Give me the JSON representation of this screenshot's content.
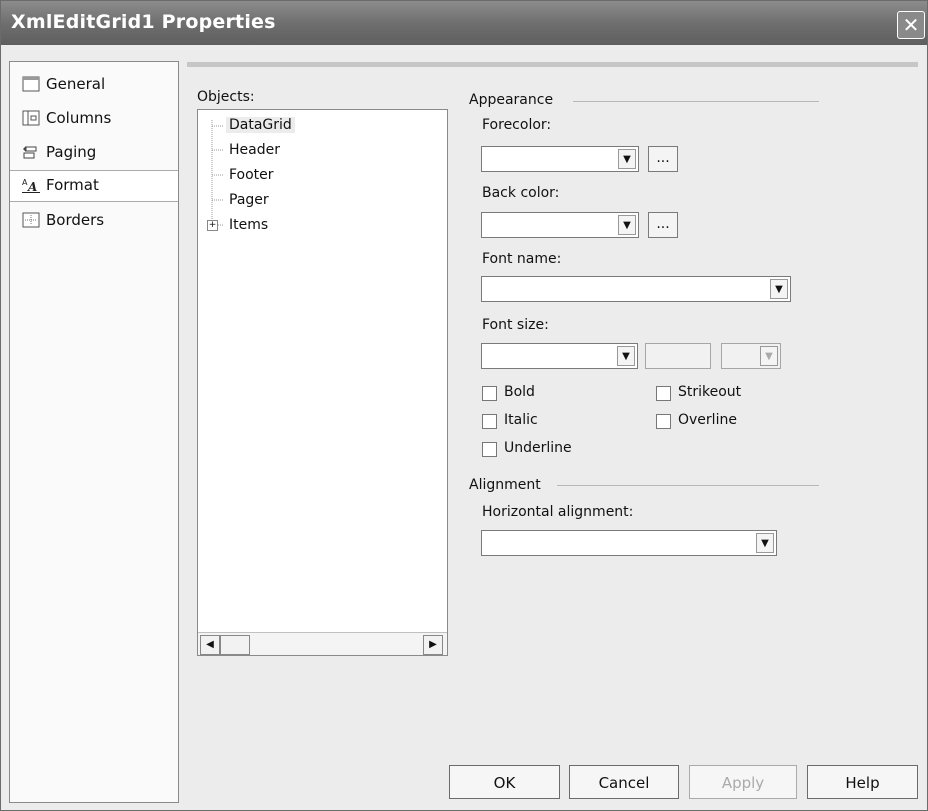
{
  "window": {
    "title": "XmlEditGrid1 Properties",
    "close_glyph": "✕"
  },
  "sidebar": {
    "items": [
      {
        "label": "General",
        "icon": "general-icon"
      },
      {
        "label": "Columns",
        "icon": "columns-icon"
      },
      {
        "label": "Paging",
        "icon": "paging-icon"
      },
      {
        "label": "Format",
        "icon": "format-icon",
        "selected": true
      },
      {
        "label": "Borders",
        "icon": "borders-icon"
      }
    ]
  },
  "objects": {
    "label": "Objects:",
    "tree": [
      "DataGrid",
      "Header",
      "Footer",
      "Pager",
      "Items"
    ],
    "expander": "+",
    "scroll_left": "◀",
    "scroll_right": "▶"
  },
  "appearance": {
    "group_label": "Appearance",
    "forecolor_label": "Forecolor:",
    "forecolor_value": "",
    "backcolor_label": "Back color:",
    "backcolor_value": "",
    "fontname_label": "Font name:",
    "fontname_value": "",
    "fontsize_label": "Font size:",
    "fontsize_value": "",
    "ellipsis": "...",
    "dropdown_arrow": "▼",
    "checkboxes": {
      "bold": "Bold",
      "italic": "Italic",
      "underline": "Underline",
      "strikeout": "Strikeout",
      "overline": "Overline"
    }
  },
  "alignment": {
    "group_label": "Alignment",
    "horizontal_label": "Horizontal alignment:",
    "horizontal_value": ""
  },
  "buttons": {
    "ok": "OK",
    "cancel": "Cancel",
    "apply": "Apply",
    "help": "Help"
  },
  "colors": {
    "titlebar": "#6f6f6f",
    "window_bg": "#ececec"
  }
}
